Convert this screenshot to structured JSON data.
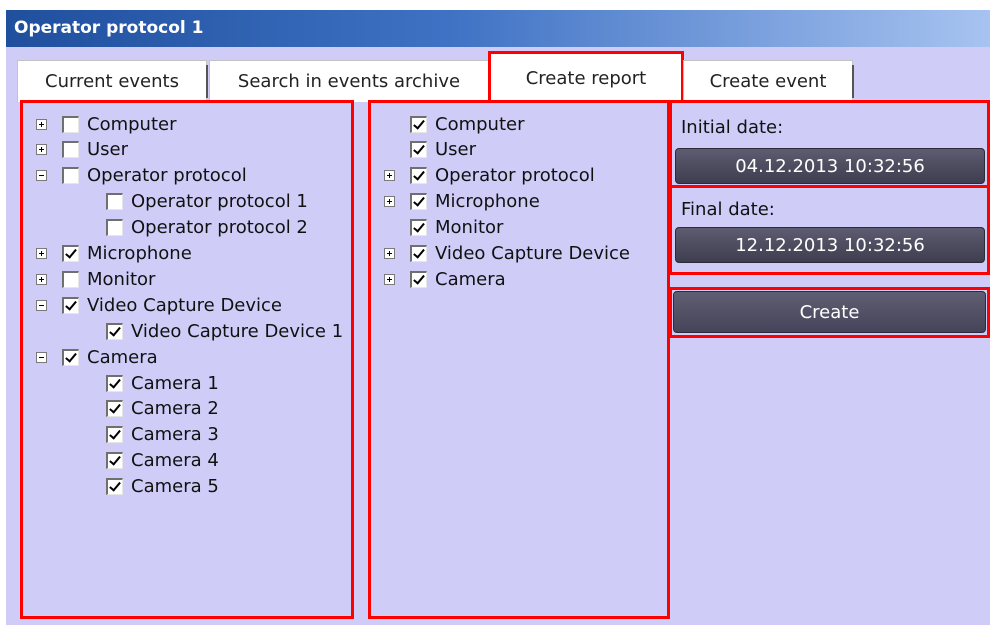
{
  "window": {
    "title": "Operator protocol 1"
  },
  "tabs": [
    {
      "label": "Current events"
    },
    {
      "label": "Search in events archive"
    },
    {
      "label": "Create report",
      "active": true
    },
    {
      "label": "Create event"
    }
  ],
  "left_tree": [
    {
      "label": "Computer",
      "expander": "plus",
      "checked": false
    },
    {
      "label": "User",
      "expander": "plus",
      "checked": false
    },
    {
      "label": "Operator protocol",
      "expander": "minus",
      "checked": false
    },
    {
      "label": "Operator protocol 1",
      "expander": null,
      "checked": false
    },
    {
      "label": "Operator protocol 2",
      "expander": null,
      "checked": false
    },
    {
      "label": "Microphone",
      "expander": "plus",
      "checked": true
    },
    {
      "label": "Monitor",
      "expander": "plus",
      "checked": false
    },
    {
      "label": "Video Capture Device",
      "expander": "minus",
      "checked": true
    },
    {
      "label": "Video Capture Device 1",
      "expander": null,
      "checked": true
    },
    {
      "label": "Camera",
      "expander": "minus",
      "checked": true
    },
    {
      "label": "Camera 1",
      "expander": null,
      "checked": true
    },
    {
      "label": "Camera 2",
      "expander": null,
      "checked": true
    },
    {
      "label": "Camera 3",
      "expander": null,
      "checked": true
    },
    {
      "label": "Camera 4",
      "expander": null,
      "checked": true
    },
    {
      "label": "Camera 5",
      "expander": null,
      "checked": true
    }
  ],
  "middle_tree": [
    {
      "label": "Computer",
      "expander": null,
      "checked": true
    },
    {
      "label": "User",
      "expander": null,
      "checked": true
    },
    {
      "label": "Operator protocol",
      "expander": "plus",
      "checked": true
    },
    {
      "label": "Microphone",
      "expander": "plus",
      "checked": true
    },
    {
      "label": "Monitor",
      "expander": null,
      "checked": true
    },
    {
      "label": "Video Capture Device",
      "expander": "plus",
      "checked": true
    },
    {
      "label": "Camera",
      "expander": "plus",
      "checked": true
    }
  ],
  "report": {
    "initial_label": "Initial date:",
    "initial_value": "04.12.2013 10:32:56",
    "final_label": "Final date:",
    "final_value": "12.12.2013 10:32:56",
    "create_label": "Create"
  },
  "colors": {
    "panel_bg": "#cfcdf8",
    "highlight": "#ff0000",
    "button_bg": "#4e4d62",
    "title_bg": "#1f4f9d"
  }
}
